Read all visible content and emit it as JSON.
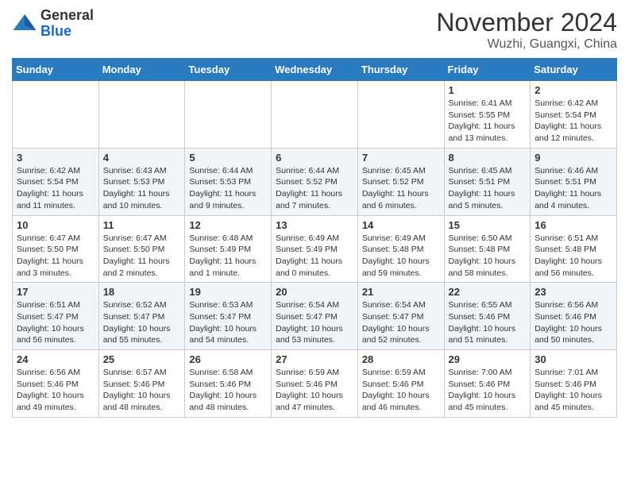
{
  "header": {
    "logo_line1": "General",
    "logo_line2": "Blue",
    "month_title": "November 2024",
    "location": "Wuzhi, Guangxi, China"
  },
  "days_of_week": [
    "Sunday",
    "Monday",
    "Tuesday",
    "Wednesday",
    "Thursday",
    "Friday",
    "Saturday"
  ],
  "weeks": [
    [
      {
        "day": "",
        "info": ""
      },
      {
        "day": "",
        "info": ""
      },
      {
        "day": "",
        "info": ""
      },
      {
        "day": "",
        "info": ""
      },
      {
        "day": "",
        "info": ""
      },
      {
        "day": "1",
        "info": "Sunrise: 6:41 AM\nSunset: 5:55 PM\nDaylight: 11 hours\nand 13 minutes."
      },
      {
        "day": "2",
        "info": "Sunrise: 6:42 AM\nSunset: 5:54 PM\nDaylight: 11 hours\nand 12 minutes."
      }
    ],
    [
      {
        "day": "3",
        "info": "Sunrise: 6:42 AM\nSunset: 5:54 PM\nDaylight: 11 hours\nand 11 minutes."
      },
      {
        "day": "4",
        "info": "Sunrise: 6:43 AM\nSunset: 5:53 PM\nDaylight: 11 hours\nand 10 minutes."
      },
      {
        "day": "5",
        "info": "Sunrise: 6:44 AM\nSunset: 5:53 PM\nDaylight: 11 hours\nand 9 minutes."
      },
      {
        "day": "6",
        "info": "Sunrise: 6:44 AM\nSunset: 5:52 PM\nDaylight: 11 hours\nand 7 minutes."
      },
      {
        "day": "7",
        "info": "Sunrise: 6:45 AM\nSunset: 5:52 PM\nDaylight: 11 hours\nand 6 minutes."
      },
      {
        "day": "8",
        "info": "Sunrise: 6:45 AM\nSunset: 5:51 PM\nDaylight: 11 hours\nand 5 minutes."
      },
      {
        "day": "9",
        "info": "Sunrise: 6:46 AM\nSunset: 5:51 PM\nDaylight: 11 hours\nand 4 minutes."
      }
    ],
    [
      {
        "day": "10",
        "info": "Sunrise: 6:47 AM\nSunset: 5:50 PM\nDaylight: 11 hours\nand 3 minutes."
      },
      {
        "day": "11",
        "info": "Sunrise: 6:47 AM\nSunset: 5:50 PM\nDaylight: 11 hours\nand 2 minutes."
      },
      {
        "day": "12",
        "info": "Sunrise: 6:48 AM\nSunset: 5:49 PM\nDaylight: 11 hours\nand 1 minute."
      },
      {
        "day": "13",
        "info": "Sunrise: 6:49 AM\nSunset: 5:49 PM\nDaylight: 11 hours\nand 0 minutes."
      },
      {
        "day": "14",
        "info": "Sunrise: 6:49 AM\nSunset: 5:48 PM\nDaylight: 10 hours\nand 59 minutes."
      },
      {
        "day": "15",
        "info": "Sunrise: 6:50 AM\nSunset: 5:48 PM\nDaylight: 10 hours\nand 58 minutes."
      },
      {
        "day": "16",
        "info": "Sunrise: 6:51 AM\nSunset: 5:48 PM\nDaylight: 10 hours\nand 56 minutes."
      }
    ],
    [
      {
        "day": "17",
        "info": "Sunrise: 6:51 AM\nSunset: 5:47 PM\nDaylight: 10 hours\nand 56 minutes."
      },
      {
        "day": "18",
        "info": "Sunrise: 6:52 AM\nSunset: 5:47 PM\nDaylight: 10 hours\nand 55 minutes."
      },
      {
        "day": "19",
        "info": "Sunrise: 6:53 AM\nSunset: 5:47 PM\nDaylight: 10 hours\nand 54 minutes."
      },
      {
        "day": "20",
        "info": "Sunrise: 6:54 AM\nSunset: 5:47 PM\nDaylight: 10 hours\nand 53 minutes."
      },
      {
        "day": "21",
        "info": "Sunrise: 6:54 AM\nSunset: 5:47 PM\nDaylight: 10 hours\nand 52 minutes."
      },
      {
        "day": "22",
        "info": "Sunrise: 6:55 AM\nSunset: 5:46 PM\nDaylight: 10 hours\nand 51 minutes."
      },
      {
        "day": "23",
        "info": "Sunrise: 6:56 AM\nSunset: 5:46 PM\nDaylight: 10 hours\nand 50 minutes."
      }
    ],
    [
      {
        "day": "24",
        "info": "Sunrise: 6:56 AM\nSunset: 5:46 PM\nDaylight: 10 hours\nand 49 minutes."
      },
      {
        "day": "25",
        "info": "Sunrise: 6:57 AM\nSunset: 5:46 PM\nDaylight: 10 hours\nand 48 minutes."
      },
      {
        "day": "26",
        "info": "Sunrise: 6:58 AM\nSunset: 5:46 PM\nDaylight: 10 hours\nand 48 minutes."
      },
      {
        "day": "27",
        "info": "Sunrise: 6:59 AM\nSunset: 5:46 PM\nDaylight: 10 hours\nand 47 minutes."
      },
      {
        "day": "28",
        "info": "Sunrise: 6:59 AM\nSunset: 5:46 PM\nDaylight: 10 hours\nand 46 minutes."
      },
      {
        "day": "29",
        "info": "Sunrise: 7:00 AM\nSunset: 5:46 PM\nDaylight: 10 hours\nand 45 minutes."
      },
      {
        "day": "30",
        "info": "Sunrise: 7:01 AM\nSunset: 5:46 PM\nDaylight: 10 hours\nand 45 minutes."
      }
    ]
  ]
}
